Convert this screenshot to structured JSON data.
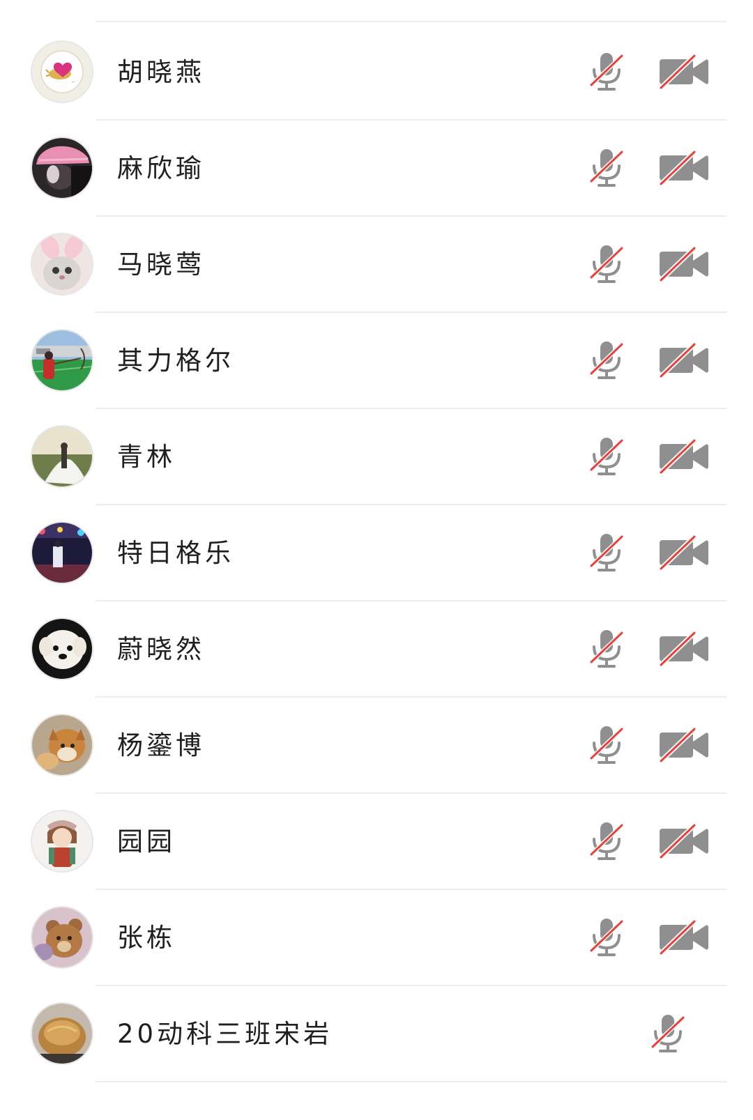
{
  "participants": [
    {
      "name": "胡晓燕",
      "avatar": "white-plate-pink-heart",
      "mic": "muted",
      "camera": "off"
    },
    {
      "name": "麻欣瑜",
      "avatar": "pink-hat-portrait",
      "mic": "muted",
      "camera": "off"
    },
    {
      "name": "马晓莺",
      "avatar": "cat-bunny-ears",
      "mic": "muted",
      "camera": "off"
    },
    {
      "name": "其力格尔",
      "avatar": "archer-on-green-field",
      "mic": "muted",
      "camera": "off"
    },
    {
      "name": "青林",
      "avatar": "wedding-couple-sunset",
      "mic": "muted",
      "camera": "off"
    },
    {
      "name": "特日格乐",
      "avatar": "stage-lights-person",
      "mic": "muted",
      "camera": "off"
    },
    {
      "name": "蔚晓然",
      "avatar": "white-puppy",
      "mic": "muted",
      "camera": "off"
    },
    {
      "name": "杨鎏博",
      "avatar": "shiba-dogs",
      "mic": "muted",
      "camera": "off"
    },
    {
      "name": "园园",
      "avatar": "cartoon-girl",
      "mic": "muted",
      "camera": "off"
    },
    {
      "name": "张栋",
      "avatar": "teddy-bear",
      "mic": "muted",
      "camera": "off"
    },
    {
      "name": "20动科三班宋岩",
      "avatar": "bread-roll",
      "mic": "muted",
      "camera": null
    }
  ],
  "icons": {
    "mic": "mic-muted-icon",
    "camera": "camera-off-icon"
  },
  "colors": {
    "icon_gray": "#8f8f8f",
    "slash_red": "#e8413c",
    "divider": "#ededed",
    "name_text": "#1f1f1f"
  }
}
